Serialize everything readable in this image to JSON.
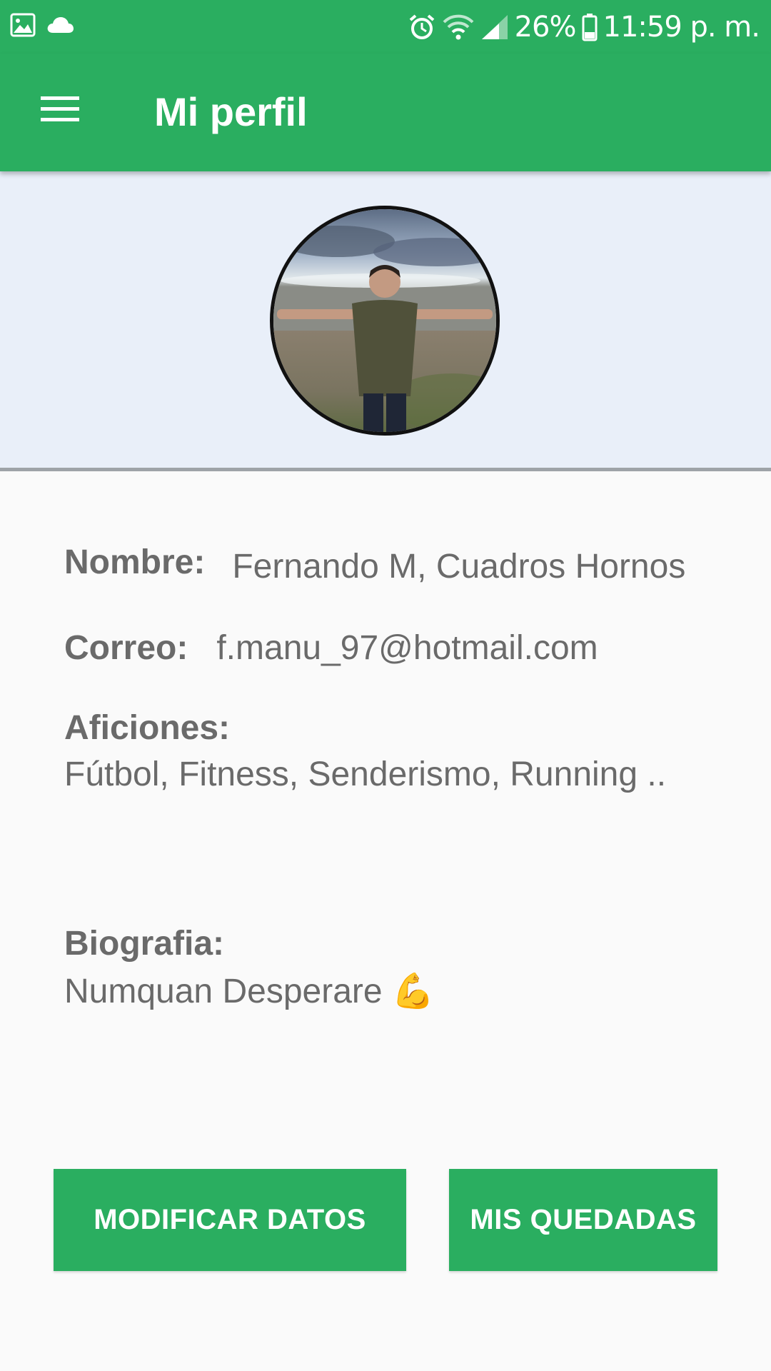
{
  "status_bar": {
    "battery_percent": "26%",
    "time": "11:59 p. m.",
    "icons": [
      "image-icon",
      "cloud-icon",
      "alarm-icon",
      "wifi-icon",
      "signal-icon",
      "battery-icon"
    ]
  },
  "toolbar": {
    "menu_icon": "hamburger-menu-icon",
    "title": "Mi perfil"
  },
  "profile": {
    "avatar": "profile-photo",
    "name_label": "Nombre:",
    "name_value": "Fernando M, Cuadros Hornos",
    "email_label": "Correo:",
    "email_value": "f.manu_97@hotmail.com",
    "hobbies_label": "Aficiones:",
    "hobbies_value": "Fútbol, Fitness, Senderismo, Running ..",
    "bio_label": "Biografia:",
    "bio_value": "Numquan Desperare 💪"
  },
  "actions": {
    "modify_label": "MODIFICAR DATOS",
    "meetups_label": "MIS QUEDADAS"
  },
  "colors": {
    "primary": "#2aae60",
    "header_bg": "#e9eff9",
    "text": "#6a6a6a",
    "background": "#fafafa"
  }
}
